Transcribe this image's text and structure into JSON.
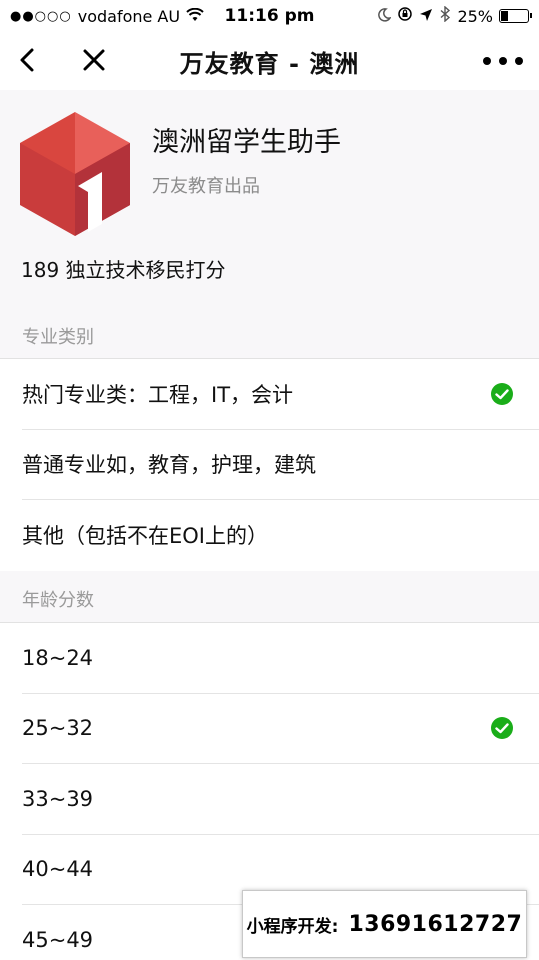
{
  "status_bar": {
    "signal": "●●○○○",
    "carrier": "vodafone AU",
    "time": "11:16 pm",
    "battery_percent": "25%",
    "battery_level": 0.25
  },
  "nav": {
    "title": "万友教育 - 澳洲"
  },
  "app": {
    "name": "澳洲留学生助手",
    "publisher": "万友教育出品",
    "subtitle": "189 独立技术移民打分",
    "logo_colors": {
      "left": "#d9463f",
      "top": "#e8605a",
      "right": "#b3323a"
    }
  },
  "sections": [
    {
      "title": "专业类别",
      "items": [
        {
          "label": "热门专业类：工程，IT，会计",
          "selected": true
        },
        {
          "label": "普通专业如，教育，护理，建筑",
          "selected": false
        },
        {
          "label": "其他（包括不在EOI上的）",
          "selected": false
        }
      ]
    },
    {
      "title": "年龄分数",
      "items": [
        {
          "label": "18~24",
          "selected": false
        },
        {
          "label": "25~32",
          "selected": true
        },
        {
          "label": "33~39",
          "selected": false
        },
        {
          "label": "40~44",
          "selected": false
        },
        {
          "label": "45~49",
          "selected": false
        }
      ]
    }
  ],
  "watermark": {
    "label": "小程序开发:",
    "phone": "13691612727"
  },
  "colors": {
    "check_green": "#1aad19",
    "background": "#f8f7f9"
  }
}
